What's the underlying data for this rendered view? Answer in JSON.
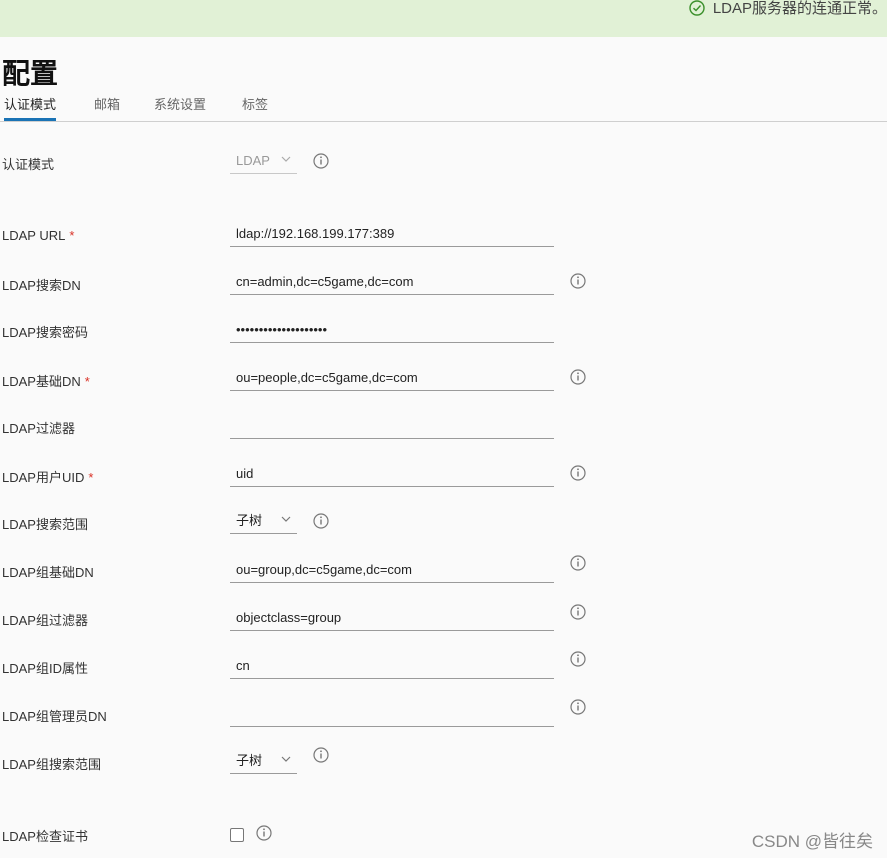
{
  "banner": {
    "message": "LDAP服务器的连通正常。",
    "icon": "check-circle-icon",
    "color": "#e1f1d6"
  },
  "page": {
    "title": "配置"
  },
  "tabs": [
    {
      "label": "认证模式",
      "active": true
    },
    {
      "label": "邮箱",
      "active": false
    },
    {
      "label": "系统设置",
      "active": false
    },
    {
      "label": "标签",
      "active": false
    }
  ],
  "form": {
    "auth_mode": {
      "label": "认证模式",
      "value": "LDAP"
    },
    "ldap_url": {
      "label": "LDAP URL",
      "required": "*",
      "value": "ldap://192.168.199.177:389"
    },
    "search_dn": {
      "label": "LDAP搜索DN",
      "value": "cn=admin,dc=c5game,dc=com"
    },
    "search_password": {
      "label": "LDAP搜索密码",
      "value": "••••••••••••••••••••"
    },
    "base_dn": {
      "label": "LDAP基础DN",
      "required": "*",
      "value": "ou=people,dc=c5game,dc=com"
    },
    "filter": {
      "label": "LDAP过滤器",
      "value": ""
    },
    "uid": {
      "label": "LDAP用户UID",
      "required": "*",
      "value": "uid"
    },
    "search_scope": {
      "label": "LDAP搜索范围",
      "value": "子树"
    },
    "group_base_dn": {
      "label": "LDAP组基础DN",
      "value": "ou=group,dc=c5game,dc=com"
    },
    "group_filter": {
      "label": "LDAP组过滤器",
      "value": "objectclass=group"
    },
    "group_id_attr": {
      "label": "LDAP组ID属性",
      "value": "cn"
    },
    "group_admin_dn": {
      "label": "LDAP组管理员DN",
      "value": ""
    },
    "group_search_scope": {
      "label": "LDAP组搜索范围",
      "value": "子树"
    },
    "verify_cert": {
      "label": "LDAP检查证书",
      "checked": false
    }
  },
  "watermark": "CSDN @皆往矣",
  "colors": {
    "accent": "#1a73b5",
    "required": "#d93025"
  }
}
